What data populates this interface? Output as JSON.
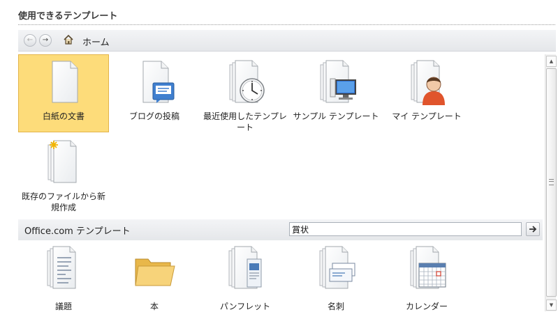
{
  "section_title": "使用できるテンプレート",
  "nav": {
    "back_icon": "back-arrow-icon",
    "forward_icon": "forward-arrow-icon",
    "home_label": "ホーム"
  },
  "templates": [
    {
      "label": "白紙の文書",
      "icon": "blank-document-icon",
      "selected": true
    },
    {
      "label": "ブログの投稿",
      "icon": "blog-post-icon"
    },
    {
      "label": "最近使用したテンプレート",
      "icon": "recent-templates-icon"
    },
    {
      "label": "サンプル テンプレート",
      "icon": "sample-templates-icon"
    },
    {
      "label": "マイ テンプレート",
      "icon": "my-templates-icon"
    },
    {
      "label": "既存のファイルから新規作成",
      "icon": "new-from-existing-icon"
    }
  ],
  "office": {
    "title": "Office.com テンプレート",
    "search_value": "賞状",
    "categories": [
      {
        "label": "議題",
        "icon": "agenda-icon"
      },
      {
        "label": "本",
        "icon": "folder-icon"
      },
      {
        "label": "パンフレット",
        "icon": "brochure-icon"
      },
      {
        "label": "名刺",
        "icon": "business-card-icon"
      },
      {
        "label": "カレンダー",
        "icon": "calendar-icon"
      }
    ]
  },
  "colors": {
    "selected_bg": "#fddc7a",
    "selected_border": "#e3b44a",
    "bar_bg": "#e9ebee"
  }
}
